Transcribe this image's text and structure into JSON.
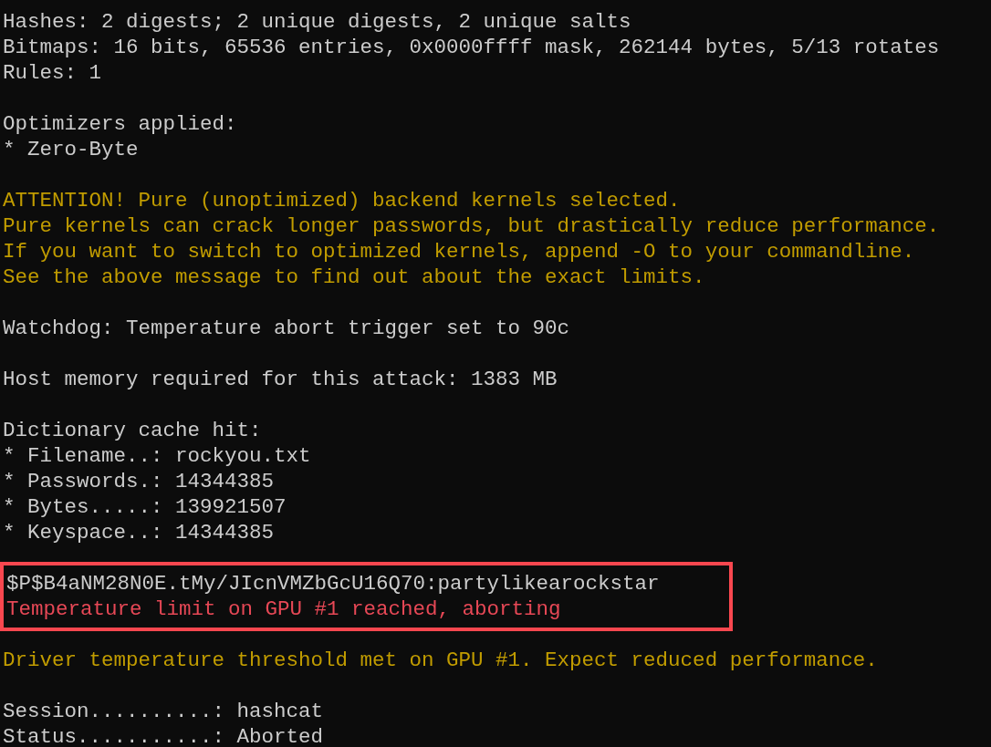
{
  "blocks": [
    {
      "highlighted": false,
      "lines": [
        {
          "kind": "output",
          "text": "Hashes: 2 digests; 2 unique digests, 2 unique salts"
        },
        {
          "kind": "output",
          "text": "Bitmaps: 16 bits, 65536 entries, 0x0000ffff mask, 262144 bytes, 5/13 rotates"
        },
        {
          "kind": "output",
          "text": "Rules: 1"
        }
      ]
    },
    {
      "highlighted": false,
      "lines": [
        {
          "kind": "output",
          "text": "Optimizers applied:"
        },
        {
          "kind": "output",
          "text": "* Zero-Byte"
        }
      ]
    },
    {
      "highlighted": false,
      "lines": [
        {
          "kind": "warning",
          "text": "ATTENTION! Pure (unoptimized) backend kernels selected."
        },
        {
          "kind": "warning",
          "text": "Pure kernels can crack longer passwords, but drastically reduce performance."
        },
        {
          "kind": "warning",
          "text": "If you want to switch to optimized kernels, append -O to your commandline."
        },
        {
          "kind": "warning",
          "text": "See the above message to find out about the exact limits."
        }
      ]
    },
    {
      "highlighted": false,
      "lines": [
        {
          "kind": "output",
          "text": "Watchdog: Temperature abort trigger set to 90c"
        }
      ]
    },
    {
      "highlighted": false,
      "lines": [
        {
          "kind": "output",
          "text": "Host memory required for this attack: 1383 MB"
        }
      ]
    },
    {
      "highlighted": false,
      "lines": [
        {
          "kind": "output",
          "text": "Dictionary cache hit:"
        },
        {
          "kind": "output",
          "text": "* Filename..: rockyou.txt"
        },
        {
          "kind": "output",
          "text": "* Passwords.: 14344385"
        },
        {
          "kind": "output",
          "text": "* Bytes.....: 139921507"
        },
        {
          "kind": "output",
          "text": "* Keyspace..: 14344385"
        }
      ]
    },
    {
      "highlighted": true,
      "lines": [
        {
          "kind": "output",
          "text": "$P$B4aNM28N0E.tMy/JIcnVMZbGcU16Q70:partylikearockstar"
        },
        {
          "kind": "error",
          "text": "Temperature limit on GPU #1 reached, aborting"
        }
      ]
    },
    {
      "highlighted": false,
      "lines": [
        {
          "kind": "warning",
          "text": "Driver temperature threshold met on GPU #1. Expect reduced performance."
        }
      ]
    },
    {
      "highlighted": false,
      "lines": [
        {
          "kind": "output",
          "text": "Session..........: hashcat"
        },
        {
          "kind": "output",
          "text": "Status...........: Aborted"
        }
      ]
    }
  ]
}
